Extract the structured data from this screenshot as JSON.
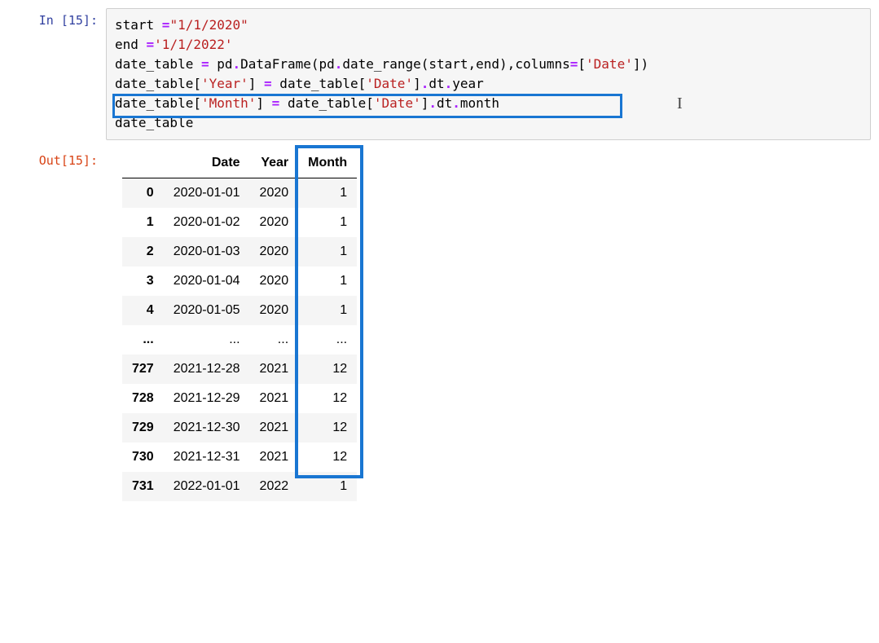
{
  "input": {
    "prompt": "In [15]:",
    "lines": [
      [
        {
          "t": "start ",
          "c": "tok-name"
        },
        {
          "t": "=",
          "c": "tok-op"
        },
        {
          "t": "\"1/1/2020\"",
          "c": "tok-str"
        }
      ],
      [
        {
          "t": "end ",
          "c": "tok-name"
        },
        {
          "t": "=",
          "c": "tok-op"
        },
        {
          "t": "'1/1/2022'",
          "c": "tok-str"
        }
      ],
      [
        {
          "t": "date_table ",
          "c": "tok-name"
        },
        {
          "t": "=",
          "c": "tok-op"
        },
        {
          "t": " pd",
          "c": "tok-name"
        },
        {
          "t": ".",
          "c": "tok-op"
        },
        {
          "t": "DataFrame(pd",
          "c": "tok-name"
        },
        {
          "t": ".",
          "c": "tok-op"
        },
        {
          "t": "date_range(start,end),columns",
          "c": "tok-name"
        },
        {
          "t": "=",
          "c": "tok-op"
        },
        {
          "t": "[",
          "c": "tok-name"
        },
        {
          "t": "'Date'",
          "c": "tok-str"
        },
        {
          "t": "])",
          "c": "tok-name"
        }
      ],
      [
        {
          "t": "date_table[",
          "c": "tok-name"
        },
        {
          "t": "'Year'",
          "c": "tok-str"
        },
        {
          "t": "] ",
          "c": "tok-name"
        },
        {
          "t": "=",
          "c": "tok-op"
        },
        {
          "t": " date_table[",
          "c": "tok-name"
        },
        {
          "t": "'Date'",
          "c": "tok-str"
        },
        {
          "t": "]",
          "c": "tok-name"
        },
        {
          "t": ".",
          "c": "tok-op"
        },
        {
          "t": "dt",
          "c": "tok-name"
        },
        {
          "t": ".",
          "c": "tok-op"
        },
        {
          "t": "year",
          "c": "tok-name"
        }
      ],
      [
        {
          "t": "date_table[",
          "c": "tok-name"
        },
        {
          "t": "'Month'",
          "c": "tok-str"
        },
        {
          "t": "] ",
          "c": "tok-name"
        },
        {
          "t": "=",
          "c": "tok-op"
        },
        {
          "t": " date_table[",
          "c": "tok-name"
        },
        {
          "t": "'Date'",
          "c": "tok-str"
        },
        {
          "t": "]",
          "c": "tok-name"
        },
        {
          "t": ".",
          "c": "tok-op"
        },
        {
          "t": "dt",
          "c": "tok-name"
        },
        {
          "t": ".",
          "c": "tok-op"
        },
        {
          "t": "month",
          "c": "tok-name"
        }
      ],
      [
        {
          "t": "date_table",
          "c": "tok-name"
        }
      ]
    ]
  },
  "output": {
    "prompt": "Out[15]:",
    "columns": [
      "Date",
      "Year",
      "Month"
    ],
    "rows": [
      {
        "idx": "0",
        "date": "2020-01-01",
        "year": "2020",
        "month": "1"
      },
      {
        "idx": "1",
        "date": "2020-01-02",
        "year": "2020",
        "month": "1"
      },
      {
        "idx": "2",
        "date": "2020-01-03",
        "year": "2020",
        "month": "1"
      },
      {
        "idx": "3",
        "date": "2020-01-04",
        "year": "2020",
        "month": "1"
      },
      {
        "idx": "4",
        "date": "2020-01-05",
        "year": "2020",
        "month": "1"
      },
      {
        "idx": "...",
        "date": "...",
        "year": "...",
        "month": "..."
      },
      {
        "idx": "727",
        "date": "2021-12-28",
        "year": "2021",
        "month": "12"
      },
      {
        "idx": "728",
        "date": "2021-12-29",
        "year": "2021",
        "month": "12"
      },
      {
        "idx": "729",
        "date": "2021-12-30",
        "year": "2021",
        "month": "12"
      },
      {
        "idx": "730",
        "date": "2021-12-31",
        "year": "2021",
        "month": "12"
      },
      {
        "idx": "731",
        "date": "2022-01-01",
        "year": "2022",
        "month": "1"
      }
    ]
  },
  "chart_data": {
    "type": "table",
    "columns": [
      "index",
      "Date",
      "Year",
      "Month"
    ],
    "rows": [
      [
        "0",
        "2020-01-01",
        2020,
        1
      ],
      [
        "1",
        "2020-01-02",
        2020,
        1
      ],
      [
        "2",
        "2020-01-03",
        2020,
        1
      ],
      [
        "3",
        "2020-01-04",
        2020,
        1
      ],
      [
        "4",
        "2020-01-05",
        2020,
        1
      ],
      [
        "...",
        "...",
        "...",
        "..."
      ],
      [
        "727",
        "2021-12-28",
        2021,
        12
      ],
      [
        "728",
        "2021-12-29",
        2021,
        12
      ],
      [
        "729",
        "2021-12-30",
        2021,
        12
      ],
      [
        "730",
        "2021-12-31",
        2021,
        12
      ],
      [
        "731",
        "2022-01-01",
        2022,
        1
      ]
    ]
  }
}
